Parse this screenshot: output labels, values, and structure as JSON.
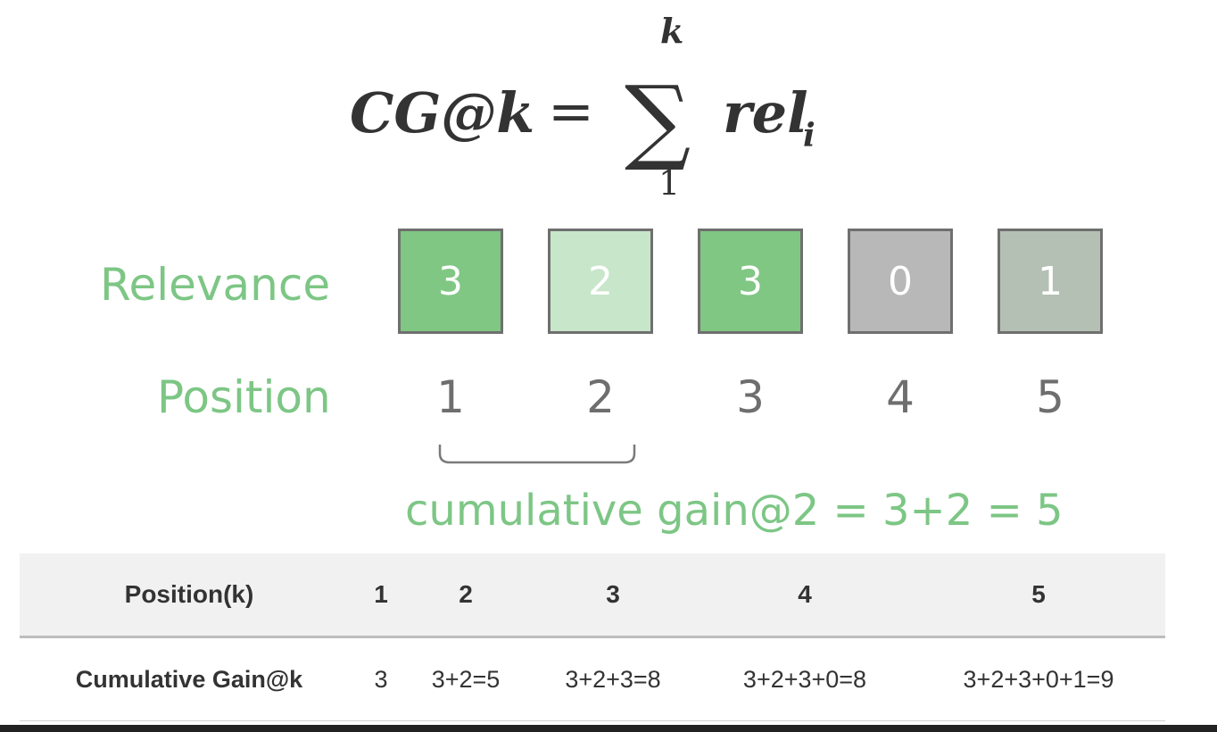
{
  "formula": {
    "lhs": "CG@k",
    "equals": "=",
    "sigma": "∑",
    "upper": "k",
    "lower": "1",
    "term": "rel",
    "subscript": "i"
  },
  "relevance_label": "Relevance",
  "position_label": "Position",
  "boxes": [
    {
      "value": "3",
      "color": "#80c784"
    },
    {
      "value": "2",
      "color": "#c8e6ca"
    },
    {
      "value": "3",
      "color": "#80c784"
    },
    {
      "value": "0",
      "color": "#b8b8b8"
    },
    {
      "value": "1",
      "color": "#b5c0b5"
    }
  ],
  "positions": [
    "1",
    "2",
    "3",
    "4",
    "5"
  ],
  "bracket_caption": "cumulative gain@2 = 3+2 = 5",
  "table": {
    "headers": [
      "Position(k)",
      "1",
      "2",
      "3",
      "4",
      "5"
    ],
    "row": [
      "Cumulative Gain@k",
      "3",
      "3+2=5",
      "3+2+3=8",
      "3+2+3+0=8",
      "3+2+3+0+1=9"
    ]
  },
  "colors": {
    "accent_green": "#7dc685",
    "text_dark": "#333333",
    "text_gray": "#6e6e6e"
  }
}
